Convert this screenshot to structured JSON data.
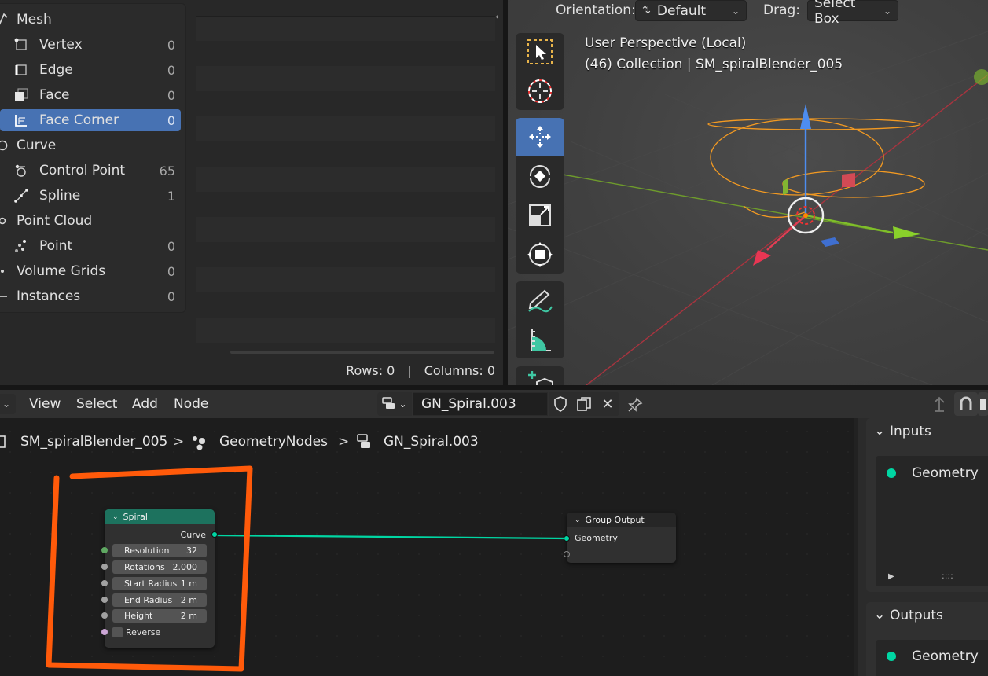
{
  "spreadsheet": {
    "tree": [
      {
        "label": "Mesh",
        "count": ""
      },
      {
        "label": "Vertex",
        "count": "0"
      },
      {
        "label": "Edge",
        "count": "0"
      },
      {
        "label": "Face",
        "count": "0"
      },
      {
        "label": "Face Corner",
        "count": "0",
        "selected": true
      },
      {
        "label": "Curve",
        "count": ""
      },
      {
        "label": "Control Point",
        "count": "65"
      },
      {
        "label": "Spline",
        "count": "1"
      },
      {
        "label": "Point Cloud",
        "count": ""
      },
      {
        "label": "Point",
        "count": "0"
      },
      {
        "label": "Volume Grids",
        "count": "0"
      },
      {
        "label": "Instances",
        "count": "0"
      }
    ],
    "rows_label": "Rows: 0",
    "status_sep": "|",
    "columns_label": "Columns: 0"
  },
  "viewport": {
    "orientation_label": "Orientation:",
    "orientation_value": "Default",
    "drag_label": "Drag:",
    "drag_value": "Select Box",
    "perspective": "User Perspective (Local)",
    "collection": "(46) Collection | SM_spiralBlender_005",
    "tools": [
      "select-box",
      "cursor",
      "move",
      "rotate",
      "scale",
      "transform",
      "annotate",
      "measure",
      "add-cube"
    ],
    "active_tool": "move"
  },
  "node_editor": {
    "menu": [
      "View",
      "Select",
      "Add",
      "Node"
    ],
    "node_tree_name": "GN_Spiral.003",
    "breadcrumb": [
      "SM_spiralBlender_005",
      "GeometryNodes",
      "GN_Spiral.003"
    ],
    "breadcrumb_sep": ">",
    "spiral_node": {
      "title": "Spiral",
      "output": "Curve",
      "fields": [
        {
          "label": "Resolution",
          "value": "32"
        },
        {
          "label": "Rotations",
          "value": "2.000"
        },
        {
          "label": "Start Radius",
          "value": "1 m"
        },
        {
          "label": "End Radius",
          "value": "2 m"
        },
        {
          "label": "Height",
          "value": "2 m"
        }
      ],
      "checkbox_label": "Reverse",
      "header_color": "#1d725e"
    },
    "group_output_node": {
      "title": "Group Output",
      "input": "Geometry"
    },
    "sidebar": {
      "inputs_title": "Inputs",
      "inputs": [
        "Geometry"
      ],
      "list_grip": "::::",
      "outputs_title": "Outputs",
      "outputs": [
        "Geometry"
      ]
    }
  },
  "colors": {
    "selection": "#4772b3",
    "geometry_socket": "#00d6a3",
    "annotation": "#ff5a0a",
    "link": "#00d6a3"
  }
}
